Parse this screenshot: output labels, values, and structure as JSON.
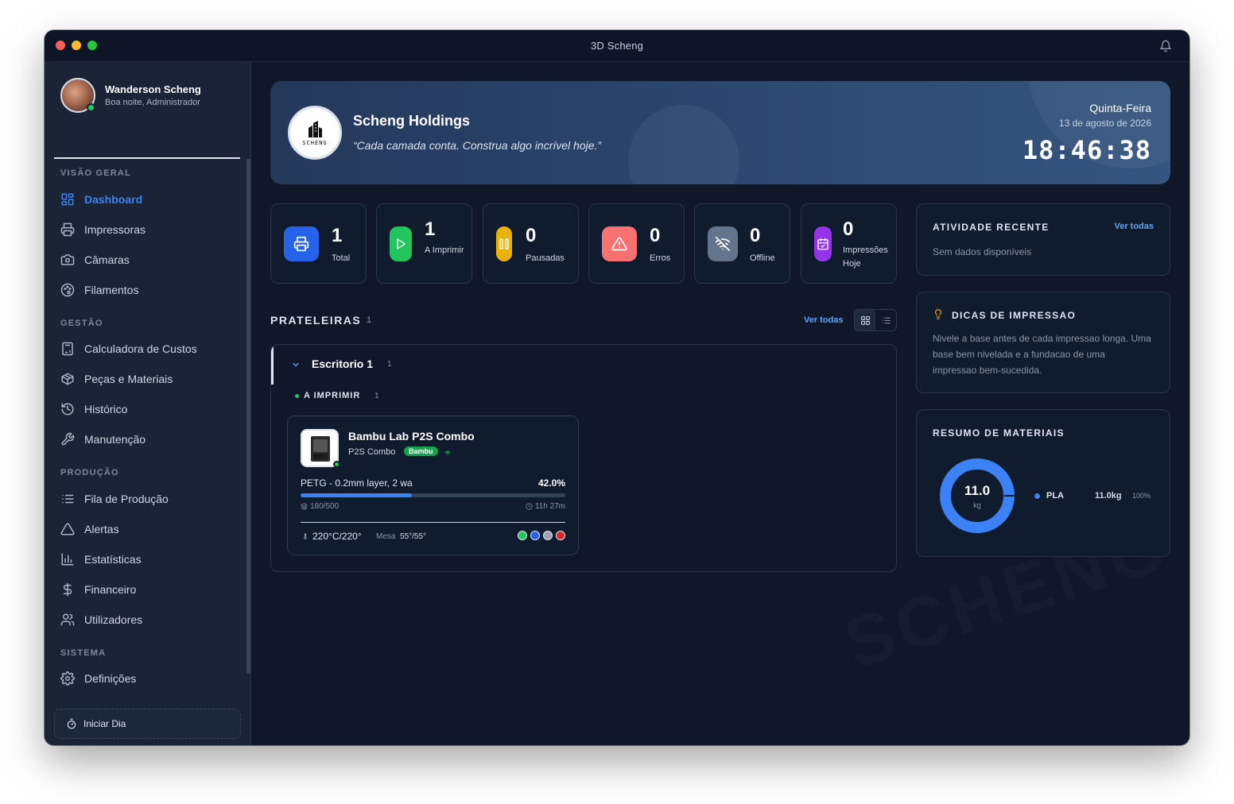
{
  "window": {
    "title": "3D Scheng"
  },
  "profile": {
    "name": "Wanderson Scheng",
    "greeting": "Boa noite, Administrador"
  },
  "sidebar": {
    "sections": {
      "overview": "VISÃO GERAL",
      "management": "GESTÃO",
      "production": "PRODUÇÃO",
      "system": "SISTEMA"
    },
    "items": {
      "dashboard": "Dashboard",
      "printers": "Impressoras",
      "cameras": "Câmaras",
      "filaments": "Filamentos",
      "cost_calc": "Calculadora de Custos",
      "parts": "Peças e Materiais",
      "history": "Histórico",
      "maintenance": "Manutenção",
      "queue": "Fila de Produção",
      "alerts": "Alertas",
      "stats": "Estatísticas",
      "finance": "Financeiro",
      "users": "Utilizadores",
      "settings": "Definições"
    },
    "start_day": "Iniciar Dia"
  },
  "hero": {
    "company": "Scheng Holdings",
    "quote": "“Cada camada conta. Construa algo incrível hoje.”",
    "logo_text": "SCHENG",
    "weekday": "Quinta-Feira",
    "date": "13 de agosto de 2026",
    "time": "18:46:38"
  },
  "stats": [
    {
      "value": "1",
      "label": "Total",
      "color": "#2563eb",
      "icon": "printer-icon"
    },
    {
      "value": "1",
      "label": "A Imprimir",
      "color": "#22c55e",
      "icon": "play-icon"
    },
    {
      "value": "0",
      "label": "Pausadas",
      "color": "#eab308",
      "icon": "pause-icon"
    },
    {
      "value": "0",
      "label": "Erros",
      "color": "#f87171",
      "icon": "warning-icon"
    },
    {
      "value": "0",
      "label": "Offline",
      "color": "#64748b",
      "icon": "wifi-off-icon"
    },
    {
      "value": "0",
      "label": "Impressões Hoje",
      "color": "#9333ea",
      "icon": "calendar-check-icon"
    }
  ],
  "shelves": {
    "title": "PRATELEIRAS",
    "count": "1",
    "see_all": "Ver todas",
    "shelf": {
      "name": "Escritorio 1",
      "count": "1",
      "status_label": "A IMPRIMIR",
      "status_count": "1"
    }
  },
  "printer": {
    "name": "Bambu Lab P2S Combo",
    "model": "P2S Combo",
    "brand": "Bambu",
    "job": "PETG - 0.2mm layer, 2 wa",
    "progress_label": "42.0%",
    "progress": 0.42,
    "layers": "180/500",
    "remaining": "11h 27m",
    "nozzle": "220°C/220°",
    "bed_label": "Mesa",
    "bed": "55°/55°",
    "colors": [
      "#22c55e",
      "#2563eb",
      "#9ca3af",
      "#dc2626"
    ]
  },
  "activity": {
    "title": "ATIVIDADE RECENTE",
    "see_all": "Ver todas",
    "empty": "Sem dados disponíveis"
  },
  "tips": {
    "title": "DICAS DE IMPRESSAO",
    "text": "Nivele a base antes de cada impressao longa. Uma base bem nivelada e a fundacao de uma impressao bem-sucedida."
  },
  "materials": {
    "title": "RESUMO DE MATERIAIS",
    "total": "11.0",
    "unit": "kg",
    "items": [
      {
        "name": "PLA",
        "weight": "11.0kg",
        "percent": "100%",
        "color": "#3b82f6"
      }
    ]
  }
}
